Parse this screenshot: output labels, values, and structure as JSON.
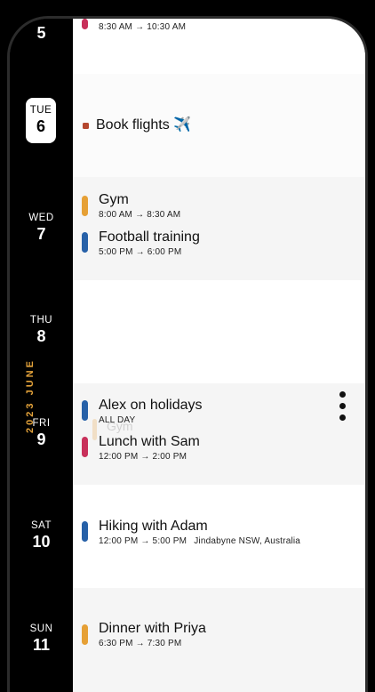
{
  "calendar": {
    "month_label": "2023 JUNE",
    "days": [
      {
        "dow": "",
        "num": "5"
      },
      {
        "dow": "TUE",
        "num": "6"
      },
      {
        "dow": "WED",
        "num": "7"
      },
      {
        "dow": "THU",
        "num": "8"
      },
      {
        "dow": "FRI",
        "num": "9"
      },
      {
        "dow": "SAT",
        "num": "10"
      },
      {
        "dow": "SUN",
        "num": "11"
      }
    ],
    "events": [
      {
        "title": "",
        "time": "8:30 AM → 10:30 AM",
        "color": "#c8305a"
      },
      {
        "title": "Book flights ✈️",
        "color": "#b5472f"
      },
      {
        "title": "Gym",
        "time": "8:00 AM → 8:30 AM",
        "color": "#e6a035"
      },
      {
        "title": "Football training",
        "time": "5:00 PM → 6:00 PM",
        "color": "#2761a8"
      },
      {
        "title": "Alex on holidays",
        "time": "ALL DAY",
        "color": "#2761a8"
      },
      {
        "title": "Lunch with Sam",
        "time": "12:00 PM → 2:00 PM",
        "color": "#c8305a"
      },
      {
        "title": "Hiking with Adam",
        "time": "12:00 PM → 5:00 PM",
        "location": "Jindabyne NSW, Australia",
        "color": "#2761a8"
      },
      {
        "title": "Dinner with Priya",
        "time": "6:30 PM → 7:30 PM",
        "color": "#e6a035"
      }
    ],
    "ghost_event": {
      "title": "Gym"
    }
  },
  "icons": {
    "more": "more-vertical-icon"
  }
}
